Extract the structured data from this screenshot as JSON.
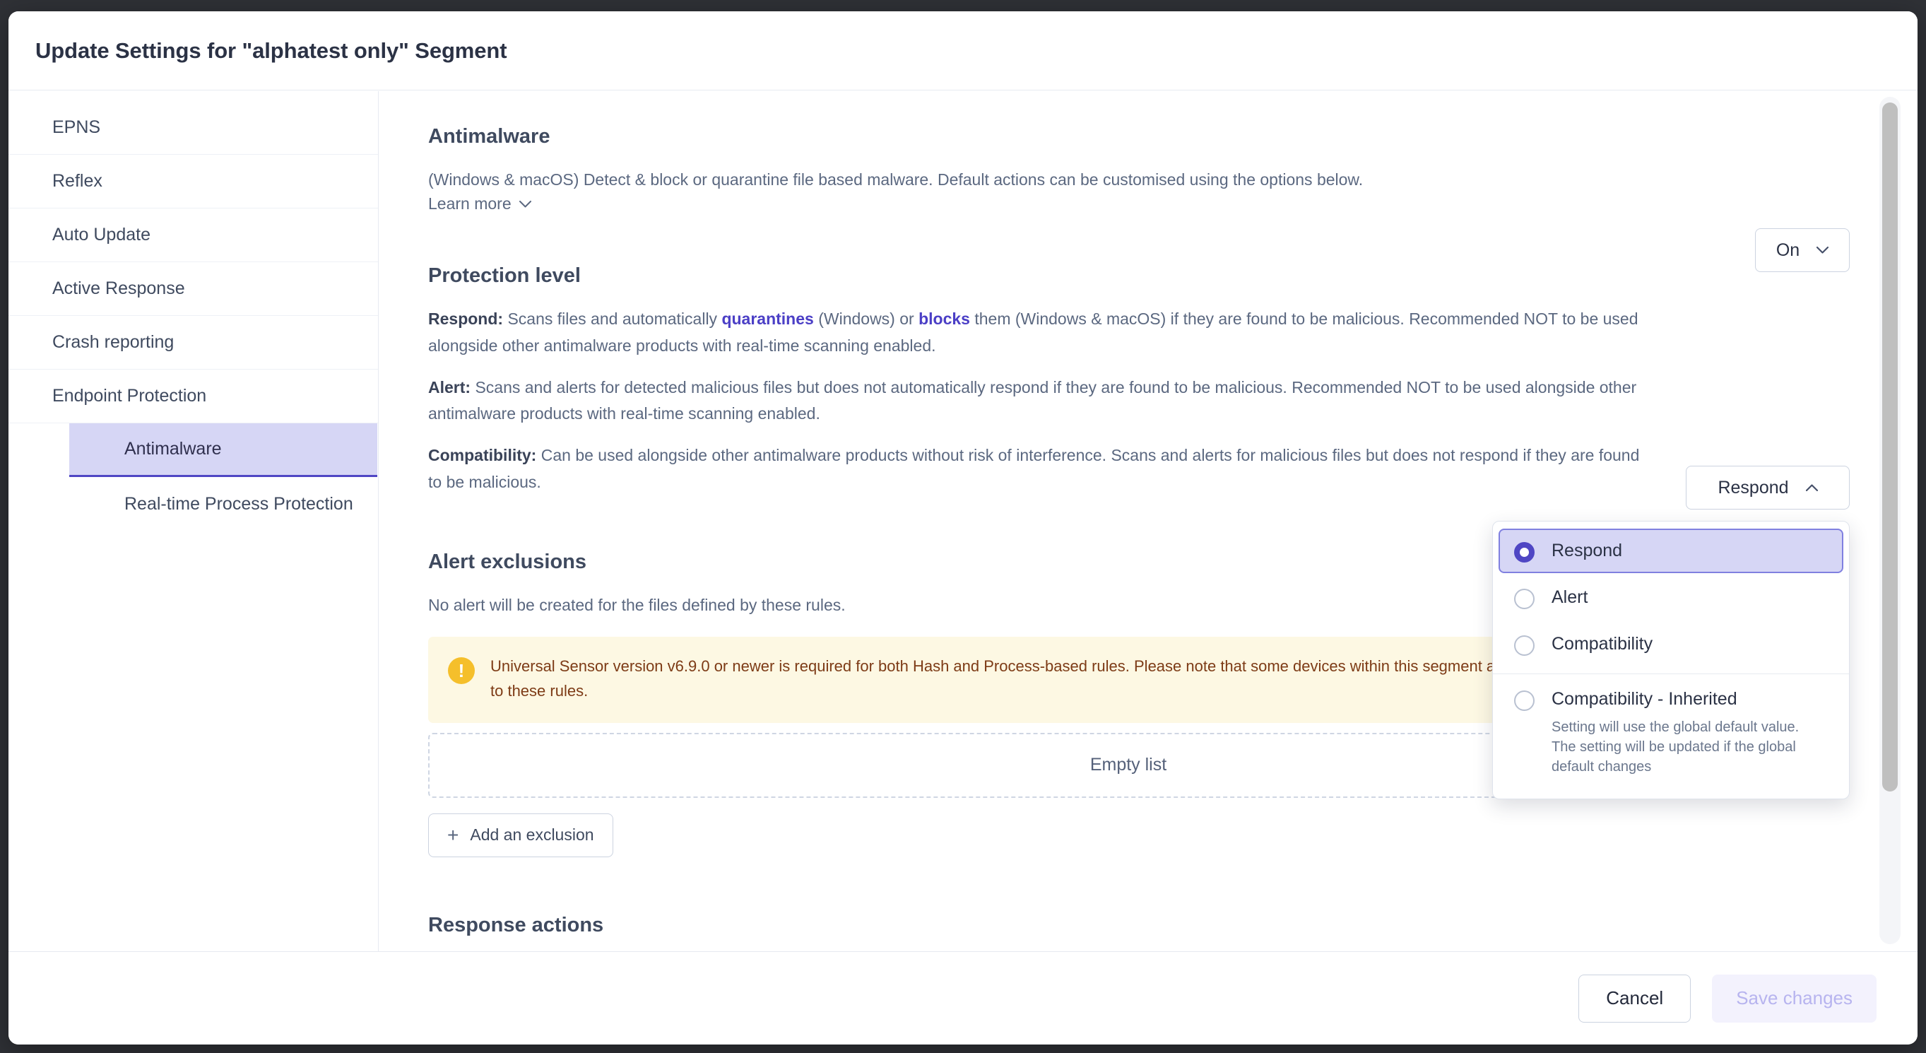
{
  "dialog": {
    "title": "Update Settings for \"alphatest only\" Segment"
  },
  "sidebar": {
    "items": [
      {
        "label": "EPNS"
      },
      {
        "label": "Reflex"
      },
      {
        "label": "Auto Update"
      },
      {
        "label": "Active Response"
      },
      {
        "label": "Crash reporting"
      },
      {
        "label": "Endpoint Protection"
      }
    ],
    "sub_items": [
      {
        "label": "Antimalware",
        "selected": true
      },
      {
        "label": "Real-time Process Protection",
        "selected": false
      }
    ]
  },
  "antimalware": {
    "heading": "Antimalware",
    "description": "(Windows & macOS) Detect & block or quarantine file based malware. Default actions can be customised using the options below.",
    "learn_more": "Learn more",
    "toggle_value": "On"
  },
  "protection_level": {
    "heading": "Protection level",
    "respond_label": "Respond:",
    "respond_text_1": " Scans files and automatically ",
    "respond_hl_1": "quarantines",
    "respond_text_2": " (Windows) or ",
    "respond_hl_2": "blocks",
    "respond_text_3": " them (Windows & macOS) if they are found to be malicious. Recommended NOT to be used alongside other antimalware products with real-time scanning enabled.",
    "alert_label": "Alert:",
    "alert_text": " Scans and alerts for detected malicious files but does not automatically respond if they are found to be malicious. Recommended NOT to be used alongside other antimalware products with real-time scanning enabled.",
    "compatibility_label": "Compatibility:",
    "compatibility_text": " Can be used alongside other antimalware products without risk of interference. Scans and alerts for malicious files but does not respond if they are found to be malicious.",
    "selected_value": "Respond",
    "options": [
      {
        "label": "Respond",
        "selected": true,
        "description": ""
      },
      {
        "label": "Alert",
        "selected": false,
        "description": ""
      },
      {
        "label": "Compatibility",
        "selected": false,
        "description": ""
      },
      {
        "label": "Compatibility - Inherited",
        "selected": false,
        "description": "Setting will use the global default value. The setting will be updated if the global default changes"
      }
    ]
  },
  "alert_exclusions": {
    "heading": "Alert exclusions",
    "description": "No alert will be created for the files defined by these rules.",
    "warning": "Universal Sensor version v6.9.0 or newer is required for both Hash and Process-based rules. Please note that some devices within this segment are running older versions and will not adhere to these rules.",
    "warning_icon": "exclamation-icon",
    "empty_label": "Empty list",
    "add_label": "Add an exclusion",
    "add_icon": "plus-icon"
  },
  "next_section": {
    "heading": "Response actions"
  },
  "footer": {
    "cancel": "Cancel",
    "save": "Save changes"
  },
  "colors": {
    "accent": "#4f46c4",
    "selected_bg": "#d6d6f5",
    "warning_bg": "#fdf8e3",
    "warning_icon": "#f5bf2b",
    "warning_text": "#7d3b16"
  }
}
